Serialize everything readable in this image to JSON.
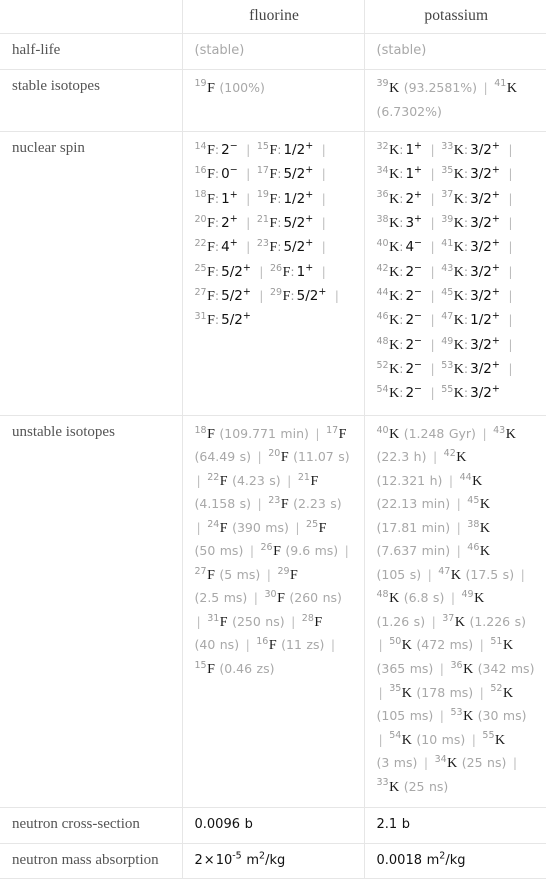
{
  "table": {
    "columns": [
      "",
      "fluorine",
      "potassium"
    ],
    "header": {
      "corner": "",
      "col1": "fluorine",
      "col2": "potassium"
    },
    "rows": [
      {
        "label": "half-life",
        "fluorine": {
          "kind": "stable-note",
          "text": "(stable)"
        },
        "potassium": {
          "kind": "stable-note",
          "text": "(stable)"
        }
      },
      {
        "label": "stable isotopes",
        "fluorine": {
          "kind": "isotope-list",
          "items": [
            {
              "mass": "19",
              "element": "F",
              "value": "(100%)"
            }
          ]
        },
        "potassium": {
          "kind": "isotope-list",
          "items": [
            {
              "mass": "39",
              "element": "K",
              "value": "(93.2581%)"
            },
            {
              "mass": "41",
              "element": "K",
              "value": "(6.7302%)"
            }
          ]
        }
      },
      {
        "label": "nuclear spin",
        "fluorine": {
          "kind": "spin-list",
          "items": [
            {
              "mass": "14",
              "element": "F",
              "spin": "2",
              "sign": "-"
            },
            {
              "mass": "15",
              "element": "F",
              "spin": "1/2",
              "sign": "+"
            },
            {
              "mass": "16",
              "element": "F",
              "spin": "0",
              "sign": "-"
            },
            {
              "mass": "17",
              "element": "F",
              "spin": "5/2",
              "sign": "+"
            },
            {
              "mass": "18",
              "element": "F",
              "spin": "1",
              "sign": "+"
            },
            {
              "mass": "19",
              "element": "F",
              "spin": "1/2",
              "sign": "+"
            },
            {
              "mass": "20",
              "element": "F",
              "spin": "2",
              "sign": "+"
            },
            {
              "mass": "21",
              "element": "F",
              "spin": "5/2",
              "sign": "+"
            },
            {
              "mass": "22",
              "element": "F",
              "spin": "4",
              "sign": "+"
            },
            {
              "mass": "23",
              "element": "F",
              "spin": "5/2",
              "sign": "+"
            },
            {
              "mass": "25",
              "element": "F",
              "spin": "5/2",
              "sign": "+"
            },
            {
              "mass": "26",
              "element": "F",
              "spin": "1",
              "sign": "+"
            },
            {
              "mass": "27",
              "element": "F",
              "spin": "5/2",
              "sign": "+"
            },
            {
              "mass": "29",
              "element": "F",
              "spin": "5/2",
              "sign": "+"
            },
            {
              "mass": "31",
              "element": "F",
              "spin": "5/2",
              "sign": "+"
            }
          ]
        },
        "potassium": {
          "kind": "spin-list",
          "items": [
            {
              "mass": "32",
              "element": "K",
              "spin": "1",
              "sign": "+"
            },
            {
              "mass": "33",
              "element": "K",
              "spin": "3/2",
              "sign": "+"
            },
            {
              "mass": "34",
              "element": "K",
              "spin": "1",
              "sign": "+"
            },
            {
              "mass": "35",
              "element": "K",
              "spin": "3/2",
              "sign": "+"
            },
            {
              "mass": "36",
              "element": "K",
              "spin": "2",
              "sign": "+"
            },
            {
              "mass": "37",
              "element": "K",
              "spin": "3/2",
              "sign": "+"
            },
            {
              "mass": "38",
              "element": "K",
              "spin": "3",
              "sign": "+"
            },
            {
              "mass": "39",
              "element": "K",
              "spin": "3/2",
              "sign": "+"
            },
            {
              "mass": "40",
              "element": "K",
              "spin": "4",
              "sign": "-"
            },
            {
              "mass": "41",
              "element": "K",
              "spin": "3/2",
              "sign": "+"
            },
            {
              "mass": "42",
              "element": "K",
              "spin": "2",
              "sign": "-"
            },
            {
              "mass": "43",
              "element": "K",
              "spin": "3/2",
              "sign": "+"
            },
            {
              "mass": "44",
              "element": "K",
              "spin": "2",
              "sign": "-"
            },
            {
              "mass": "45",
              "element": "K",
              "spin": "3/2",
              "sign": "+"
            },
            {
              "mass": "46",
              "element": "K",
              "spin": "2",
              "sign": "-"
            },
            {
              "mass": "47",
              "element": "K",
              "spin": "1/2",
              "sign": "+"
            },
            {
              "mass": "48",
              "element": "K",
              "spin": "2",
              "sign": "-"
            },
            {
              "mass": "49",
              "element": "K",
              "spin": "3/2",
              "sign": "+"
            },
            {
              "mass": "52",
              "element": "K",
              "spin": "2",
              "sign": "-"
            },
            {
              "mass": "53",
              "element": "K",
              "spin": "3/2",
              "sign": "+"
            },
            {
              "mass": "54",
              "element": "K",
              "spin": "2",
              "sign": "-"
            },
            {
              "mass": "55",
              "element": "K",
              "spin": "3/2",
              "sign": "+"
            }
          ]
        }
      },
      {
        "label": "unstable isotopes",
        "fluorine": {
          "kind": "isotope-list",
          "items": [
            {
              "mass": "18",
              "element": "F",
              "value": "(109.771 min)"
            },
            {
              "mass": "17",
              "element": "F",
              "value": "(64.49 s)"
            },
            {
              "mass": "20",
              "element": "F",
              "value": "(11.07 s)"
            },
            {
              "mass": "22",
              "element": "F",
              "value": "(4.23 s)"
            },
            {
              "mass": "21",
              "element": "F",
              "value": "(4.158 s)"
            },
            {
              "mass": "23",
              "element": "F",
              "value": "(2.23 s)"
            },
            {
              "mass": "24",
              "element": "F",
              "value": "(390 ms)"
            },
            {
              "mass": "25",
              "element": "F",
              "value": "(50 ms)"
            },
            {
              "mass": "26",
              "element": "F",
              "value": "(9.6 ms)"
            },
            {
              "mass": "27",
              "element": "F",
              "value": "(5 ms)"
            },
            {
              "mass": "29",
              "element": "F",
              "value": "(2.5 ms)"
            },
            {
              "mass": "30",
              "element": "F",
              "value": "(260 ns)"
            },
            {
              "mass": "31",
              "element": "F",
              "value": "(250 ns)"
            },
            {
              "mass": "28",
              "element": "F",
              "value": "(40 ns)"
            },
            {
              "mass": "16",
              "element": "F",
              "value": "(11 zs)"
            },
            {
              "mass": "15",
              "element": "F",
              "value": "(0.46 zs)"
            }
          ]
        },
        "potassium": {
          "kind": "isotope-list",
          "items": [
            {
              "mass": "40",
              "element": "K",
              "value": "(1.248 Gyr)"
            },
            {
              "mass": "43",
              "element": "K",
              "value": "(22.3 h)"
            },
            {
              "mass": "42",
              "element": "K",
              "value": "(12.321 h)"
            },
            {
              "mass": "44",
              "element": "K",
              "value": "(22.13 min)"
            },
            {
              "mass": "45",
              "element": "K",
              "value": "(17.81 min)"
            },
            {
              "mass": "38",
              "element": "K",
              "value": "(7.637 min)"
            },
            {
              "mass": "46",
              "element": "K",
              "value": "(105 s)"
            },
            {
              "mass": "47",
              "element": "K",
              "value": "(17.5 s)"
            },
            {
              "mass": "48",
              "element": "K",
              "value": "(6.8 s)"
            },
            {
              "mass": "49",
              "element": "K",
              "value": "(1.26 s)"
            },
            {
              "mass": "37",
              "element": "K",
              "value": "(1.226 s)"
            },
            {
              "mass": "50",
              "element": "K",
              "value": "(472 ms)"
            },
            {
              "mass": "51",
              "element": "K",
              "value": "(365 ms)"
            },
            {
              "mass": "36",
              "element": "K",
              "value": "(342 ms)"
            },
            {
              "mass": "35",
              "element": "K",
              "value": "(178 ms)"
            },
            {
              "mass": "52",
              "element": "K",
              "value": "(105 ms)"
            },
            {
              "mass": "53",
              "element": "K",
              "value": "(30 ms)"
            },
            {
              "mass": "54",
              "element": "K",
              "value": "(10 ms)"
            },
            {
              "mass": "55",
              "element": "K",
              "value": "(3 ms)"
            },
            {
              "mass": "34",
              "element": "K",
              "value": "(25 ns)"
            },
            {
              "mass": "33",
              "element": "K",
              "value": "(25 ns)"
            }
          ]
        }
      },
      {
        "label": "neutron cross-section",
        "fluorine": {
          "kind": "plain",
          "text": "0.0096 b"
        },
        "potassium": {
          "kind": "plain",
          "text": "2.1 b"
        }
      },
      {
        "label": "neutron mass absorption",
        "fluorine": {
          "kind": "sci",
          "mantissa": "2",
          "times": "×",
          "base": "10",
          "exponent": "-5",
          "unit": "m2/kg",
          "text": "2×10^-5 m^2/kg"
        },
        "potassium": {
          "kind": "sci",
          "mantissa": "0.0018",
          "times": "",
          "base": "",
          "exponent": "",
          "unit": "m2/kg",
          "text": "0.0018 m^2/kg"
        }
      }
    ]
  },
  "colors": {
    "border": "#e6e6e6",
    "label_text": "#555555",
    "value_text": "#1a1a1a",
    "muted_text": "#a8a8a8",
    "separator": "#bdbdbd"
  }
}
